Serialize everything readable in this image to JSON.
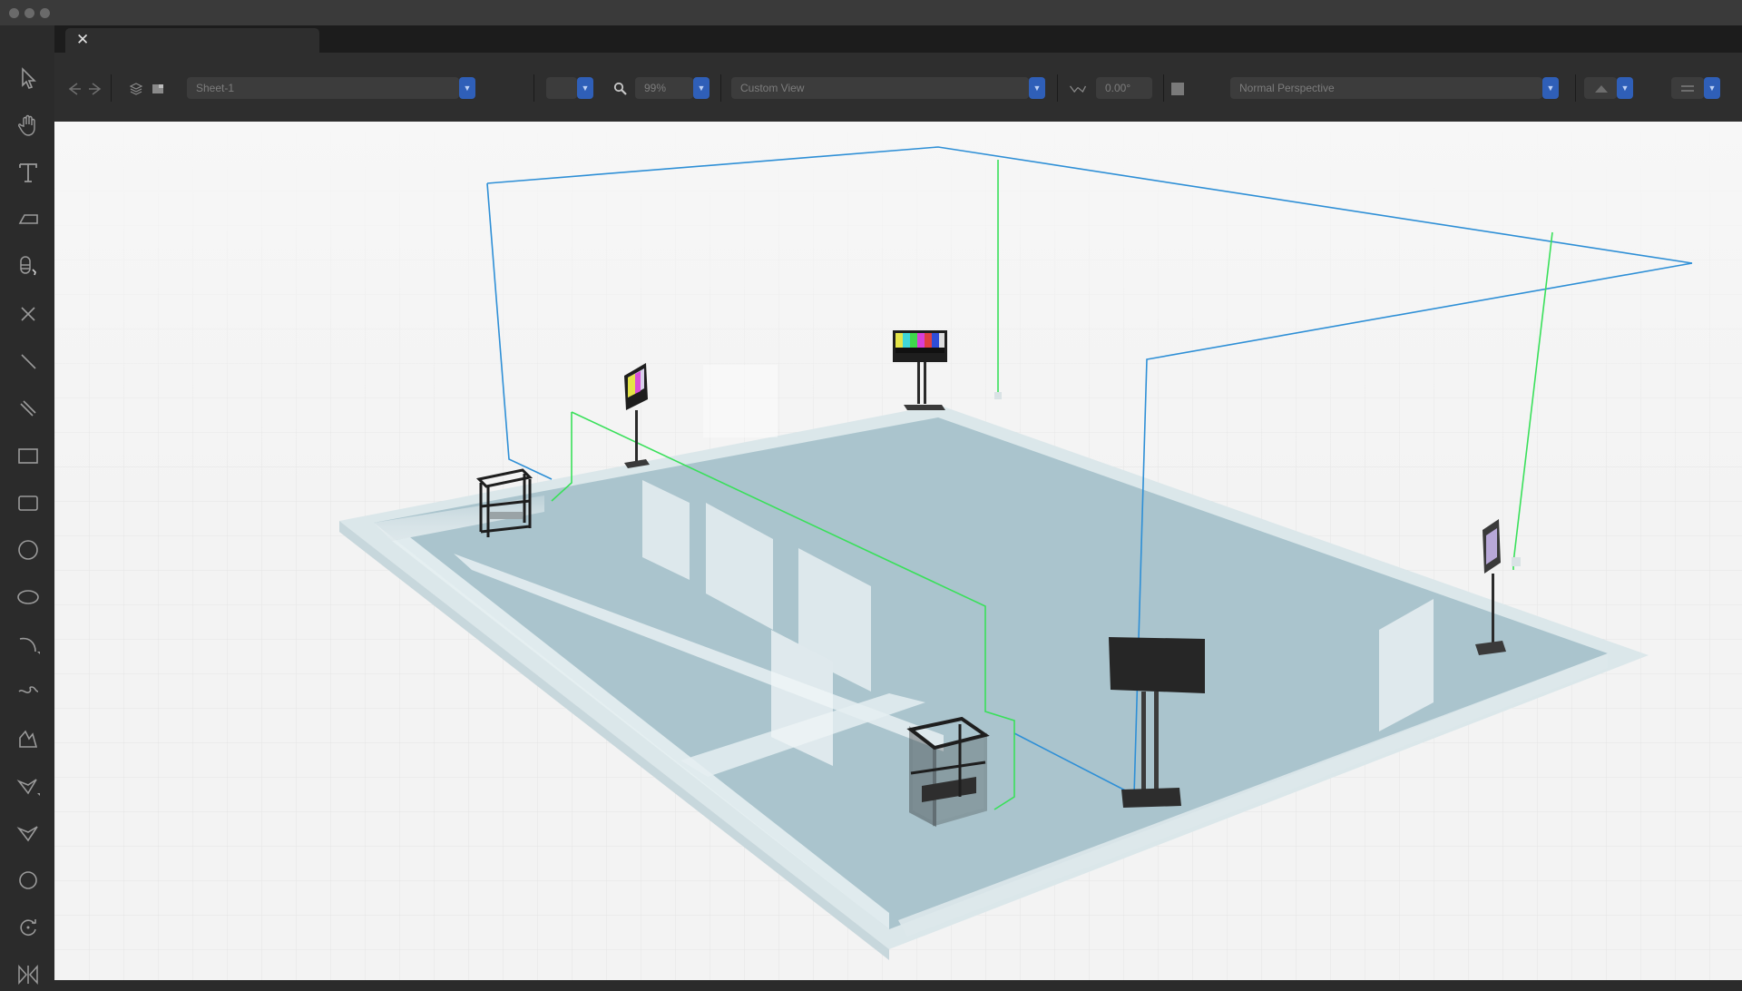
{
  "document": {
    "tab_close": "✕"
  },
  "toolbox": {
    "tools": [
      {
        "name": "selection-tool",
        "icon": "arrow-cursor-icon"
      },
      {
        "name": "pan-tool",
        "icon": "hand-icon"
      },
      {
        "name": "text-tool",
        "icon": "text-t-icon"
      },
      {
        "name": "dimension-tool",
        "icon": "dimension-icon"
      },
      {
        "name": "flyover-tool",
        "icon": "flyover-icon"
      },
      {
        "name": "eraser-tool",
        "icon": "x-icon"
      },
      {
        "name": "line-tool",
        "icon": "line-icon"
      },
      {
        "name": "double-line-tool",
        "icon": "double-line-icon"
      },
      {
        "name": "rectangle-tool",
        "icon": "rectangle-icon"
      },
      {
        "name": "rounded-rectangle-tool",
        "icon": "rounded-rectangle-icon"
      },
      {
        "name": "circle-tool",
        "icon": "circle-icon"
      },
      {
        "name": "oval-tool",
        "icon": "oval-icon"
      },
      {
        "name": "arc-tool",
        "icon": "arc-icon"
      },
      {
        "name": "freehand-tool",
        "icon": "freehand-icon"
      },
      {
        "name": "polyline-tool",
        "icon": "polyline-icon"
      },
      {
        "name": "polygon-tool",
        "icon": "polygon-icon"
      },
      {
        "name": "regular-polygon-tool",
        "icon": "regular-polygon-icon"
      },
      {
        "name": "spiral-tool",
        "icon": "spiral-icon"
      },
      {
        "name": "rotate-tool",
        "icon": "rotate-icon"
      },
      {
        "name": "mirror-tool",
        "icon": "mirror-icon"
      }
    ]
  },
  "viewbar": {
    "sheet": "Sheet-1",
    "scale": "",
    "zoom": "99%",
    "view": "Custom View",
    "angle": "0.00°",
    "projection": "Normal Perspective",
    "render": "",
    "layer_options": ""
  },
  "scene": {
    "colors": {
      "floor": "#a9c4cd",
      "floor_edge": "#cfdee3",
      "wall": "#e4eef1",
      "blue_rig": "#2e8fd6",
      "green_rig": "#39e05a",
      "equipment": "#1e1e1e",
      "viewport_bg": "#f3f3f3"
    }
  }
}
